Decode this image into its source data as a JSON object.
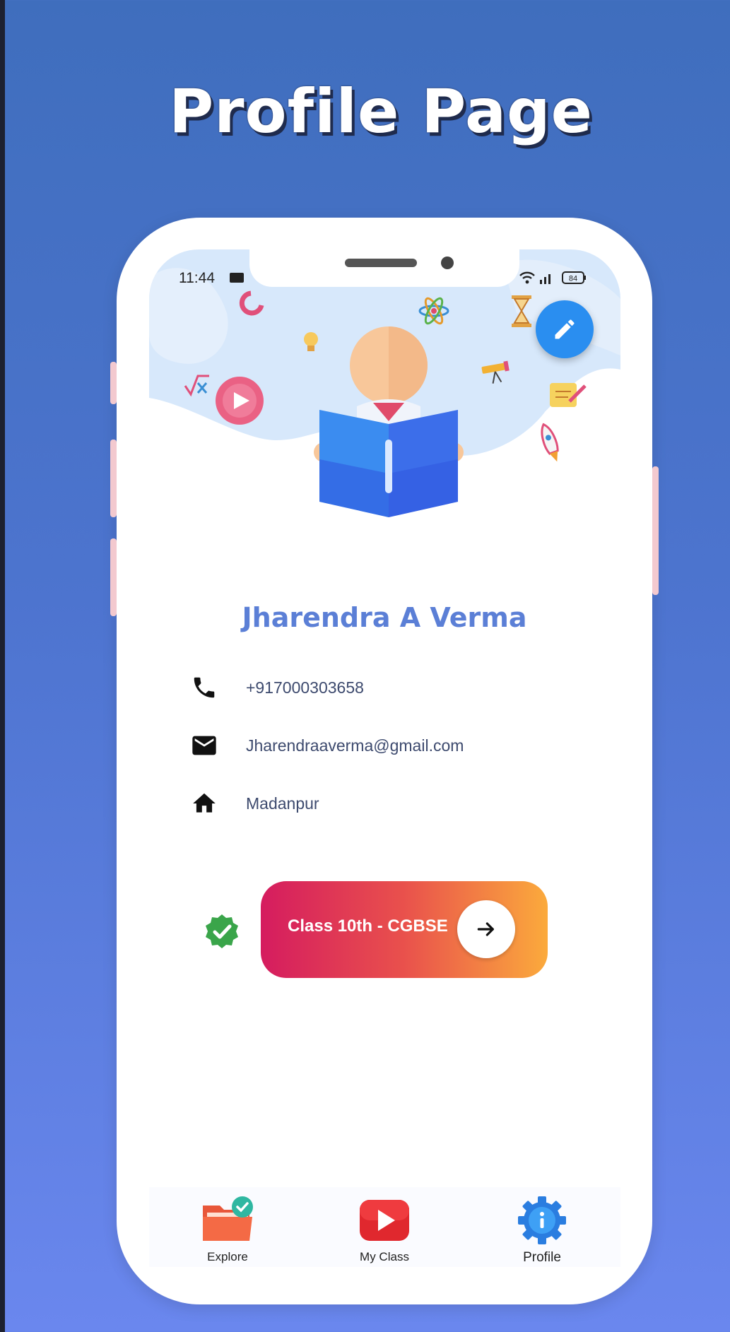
{
  "banner": {
    "title": "Profile Page"
  },
  "status_bar": {
    "time": "11:44",
    "battery": "84"
  },
  "profile": {
    "name": "Jharendra A Verma",
    "phone": "+917000303658",
    "email": "Jharendraaverma@gmail.com",
    "address": "Madanpur"
  },
  "class_card": {
    "label": "Class 10th - CGBSE"
  },
  "bottom_nav": {
    "items": [
      {
        "label": "Explore",
        "icon": "folder-check-icon"
      },
      {
        "label": "My Class",
        "icon": "play-icon"
      },
      {
        "label": "Profile",
        "icon": "info-gear-icon"
      }
    ],
    "active": "Profile"
  },
  "colors": {
    "background_top": "#3f6ebd",
    "background_bottom": "#6a87ee",
    "name_text": "#5b7fd6",
    "fab": "#2a8ef0",
    "card_gradient_start": "#d51c5f",
    "card_gradient_end": "#fbaa3c",
    "verified": "#3aa54a"
  }
}
